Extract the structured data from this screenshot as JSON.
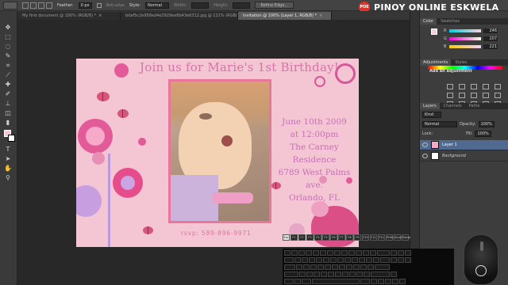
{
  "options_bar": {
    "feather_label": "Feather:",
    "feather_value": "0 px",
    "anti_alias_label": "Anti-alias",
    "style_label": "Style:",
    "style_value": "Normal",
    "width_label": "Width:",
    "height_label": "Height:",
    "refine_edge_label": "Refine Edge..."
  },
  "tabs": [
    {
      "label": "My first document @ 100% (RGB/8) *",
      "active": false
    },
    {
      "label": "bdaf5c2e958ed4e3929ee8b43e6312.jpg @ 121% (RGB/8) *",
      "active": false
    },
    {
      "label": "invitation @ 100% (Layer 1, RGB/8) *",
      "active": true
    }
  ],
  "artwork": {
    "heading": "Join us for Marie's 1st Birthday!",
    "details": [
      "June 10th 2009",
      "at 12:00pm",
      "The Carney Residence",
      "6789 West Palms ave.",
      "Orlando, FL"
    ],
    "rsvp": "rsvp: 589-896-9971",
    "colors": {
      "background": "#f4c6d4",
      "frame": "#e8769c",
      "heading": "#d773a6",
      "details": "#c86fb6"
    }
  },
  "color_panel": {
    "tabs": [
      "Color",
      "Swatches"
    ],
    "channels": [
      {
        "label": "R",
        "value": "246"
      },
      {
        "label": "G",
        "value": "207"
      },
      {
        "label": "B",
        "value": "221"
      }
    ]
  },
  "adjustments_panel": {
    "tabs": [
      "Adjustments",
      "Styles"
    ],
    "title": "Add an adjustment"
  },
  "layers_panel": {
    "tabs": [
      "Layers",
      "Channels",
      "Paths"
    ],
    "kind_label": "Kind",
    "blend_mode": "Normal",
    "opacity_label": "Opacity:",
    "opacity_value": "100%",
    "lock_label": "Lock:",
    "fill_label": "Fill:",
    "fill_value": "100%",
    "layers": [
      {
        "name": "Layer 1",
        "selected": true
      },
      {
        "name": "Background",
        "selected": false
      }
    ]
  },
  "watermark": {
    "logo_text": "POE",
    "text": "PINOY ONLINE ESKWELA"
  },
  "keyboard": {
    "function_keys": [
      "Esc",
      "F1",
      "F2",
      "F3",
      "F4",
      "F5",
      "F6",
      "F7",
      "F8",
      "F9",
      "F10",
      "F11",
      "F12",
      "PrtSc",
      "Scroll",
      "Pause"
    ]
  }
}
